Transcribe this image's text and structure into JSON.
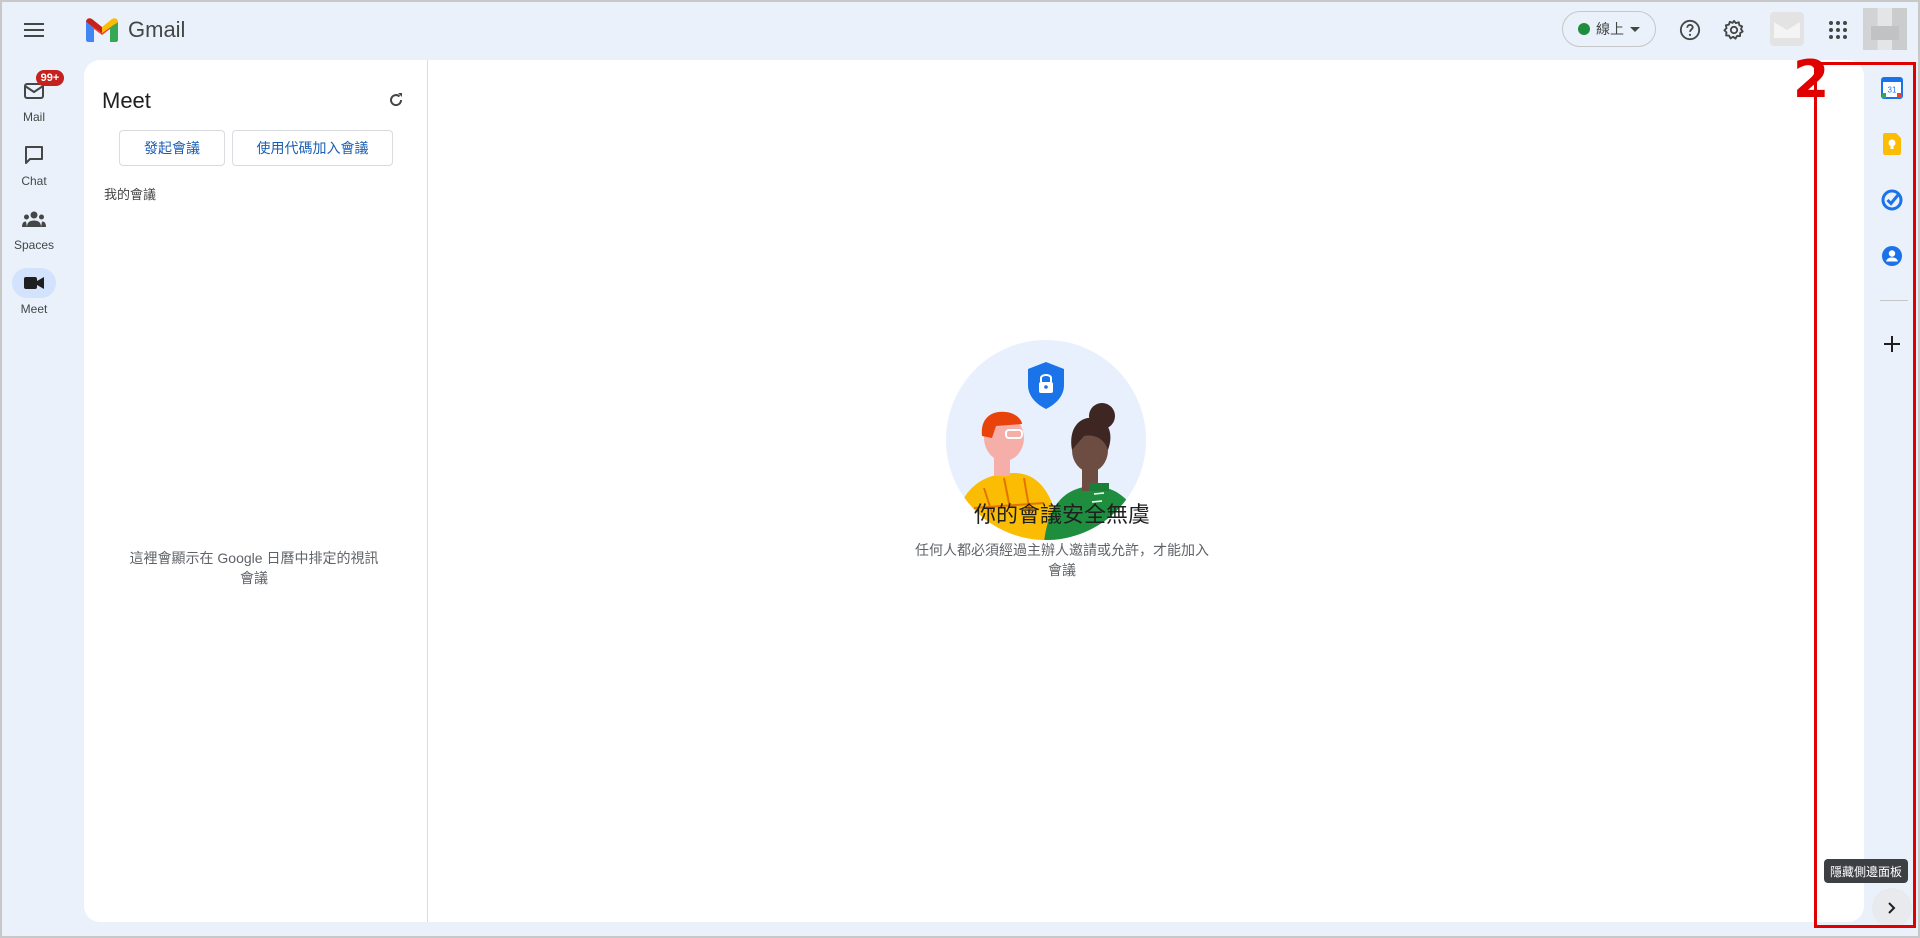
{
  "header": {
    "app_name": "Gmail",
    "status_label": "線上",
    "status_color": "#1e8e3e"
  },
  "rail": {
    "items": [
      {
        "label": "Mail",
        "icon": "mail-icon",
        "badge": "99+"
      },
      {
        "label": "Chat",
        "icon": "chat-icon"
      },
      {
        "label": "Spaces",
        "icon": "spaces-icon"
      },
      {
        "label": "Meet",
        "icon": "video-camera-icon",
        "active": true
      }
    ]
  },
  "meet": {
    "title": "Meet",
    "start_meeting": "發起會議",
    "join_with_code": "使用代碼加入會議",
    "my_meetings": "我的會議",
    "empty_note": "這裡會顯示在 Google 日曆中排定的視訊會議"
  },
  "hero": {
    "title": "你的會議安全無虞",
    "description": "任何人都必須經過主辦人邀請或允許，才能加入會議"
  },
  "side_panel": {
    "apps": [
      "calendar-icon",
      "keep-icon",
      "tasks-icon",
      "contacts-icon"
    ],
    "calendar_day": "31",
    "hide_tooltip": "隱藏側邊面板"
  },
  "annotation": {
    "number": "2",
    "color": "#e00000"
  }
}
